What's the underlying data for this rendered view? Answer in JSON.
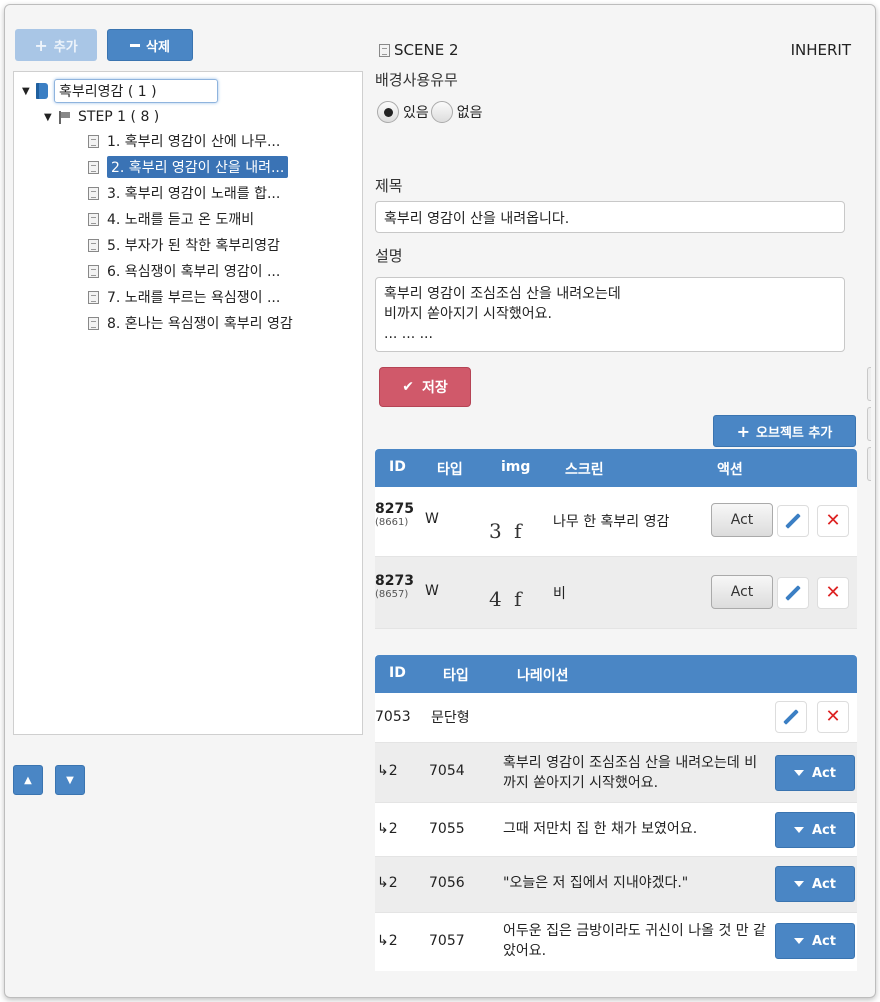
{
  "toolbar": {
    "add_label": "추가",
    "delete_label": "삭제"
  },
  "tree": {
    "root": "혹부리영감 ( 1 )",
    "step": "STEP 1 ( 8 )",
    "scenes": [
      "1. 혹부리 영감이 산에 나무...",
      "2. 혹부리 영감이 산을 내려...",
      "3. 혹부리 영감이 노래를 합...",
      "4. 노래를 듣고 온 도깨비",
      "5. 부자가 된 착한 혹부리영감",
      "6. 욕심쟁이 혹부리 영감이 ...",
      "7. 노래를 부르는 욕심쟁이 ...",
      "8. 혼나는 욕심쟁이 혹부리 영감"
    ]
  },
  "scene": {
    "title": "SCENE 2",
    "inherit": "INHERIT",
    "bg_label": "배경사용유무",
    "radio_yes": "있음",
    "radio_no": "없음",
    "title_label": "제목",
    "title_value": "혹부리 영감이 산을 내려옵니다.",
    "desc_label": "설명",
    "desc_value": "혹부리 영감이 조심조심 산을 내려오는데\n비까지 쏟아지기 시작했어요.\n  ...  ...  ...",
    "save_label": "저장",
    "add_object_label": "오브젝트 추가"
  },
  "object_table": {
    "headers": {
      "id": "ID",
      "type": "타입",
      "img": "img",
      "screen": "스크린",
      "action": "액션"
    },
    "rows": [
      {
        "id": "8275",
        "sub_id": "(8661)",
        "type": "W",
        "thumb": "3 f",
        "screen": "나무 한 혹부리 영감",
        "act": "Act"
      },
      {
        "id": "8273",
        "sub_id": "(8657)",
        "type": "W",
        "thumb": "4 f",
        "screen": "비",
        "act": "Act"
      }
    ]
  },
  "narration_table": {
    "headers": {
      "id": "ID",
      "type": "타입",
      "narration": "나레이션"
    },
    "top_row": {
      "id": "7053",
      "type": "문단형"
    },
    "rows": [
      {
        "level": "↳2",
        "id": "7054",
        "text": "혹부리 영감이 조심조심 산을 내려오는데 비까지 쏟아지기 시작했어요.",
        "act": "Act"
      },
      {
        "level": "↳2",
        "id": "7055",
        "text": "그때 저만치 집 한 채가 보였어요.",
        "act": "Act"
      },
      {
        "level": "↳2",
        "id": "7056",
        "text": "\"오늘은 저 집에서 지내야겠다.\"",
        "act": "Act"
      },
      {
        "level": "↳2",
        "id": "7057",
        "text": "어두운 집은 금방이라도 귀신이 나올 것 만 같았어요.",
        "act": "Act"
      }
    ]
  },
  "colors": {
    "accent": "#4a86c5",
    "danger": "#d0596a",
    "selected": "#3a73b5"
  }
}
